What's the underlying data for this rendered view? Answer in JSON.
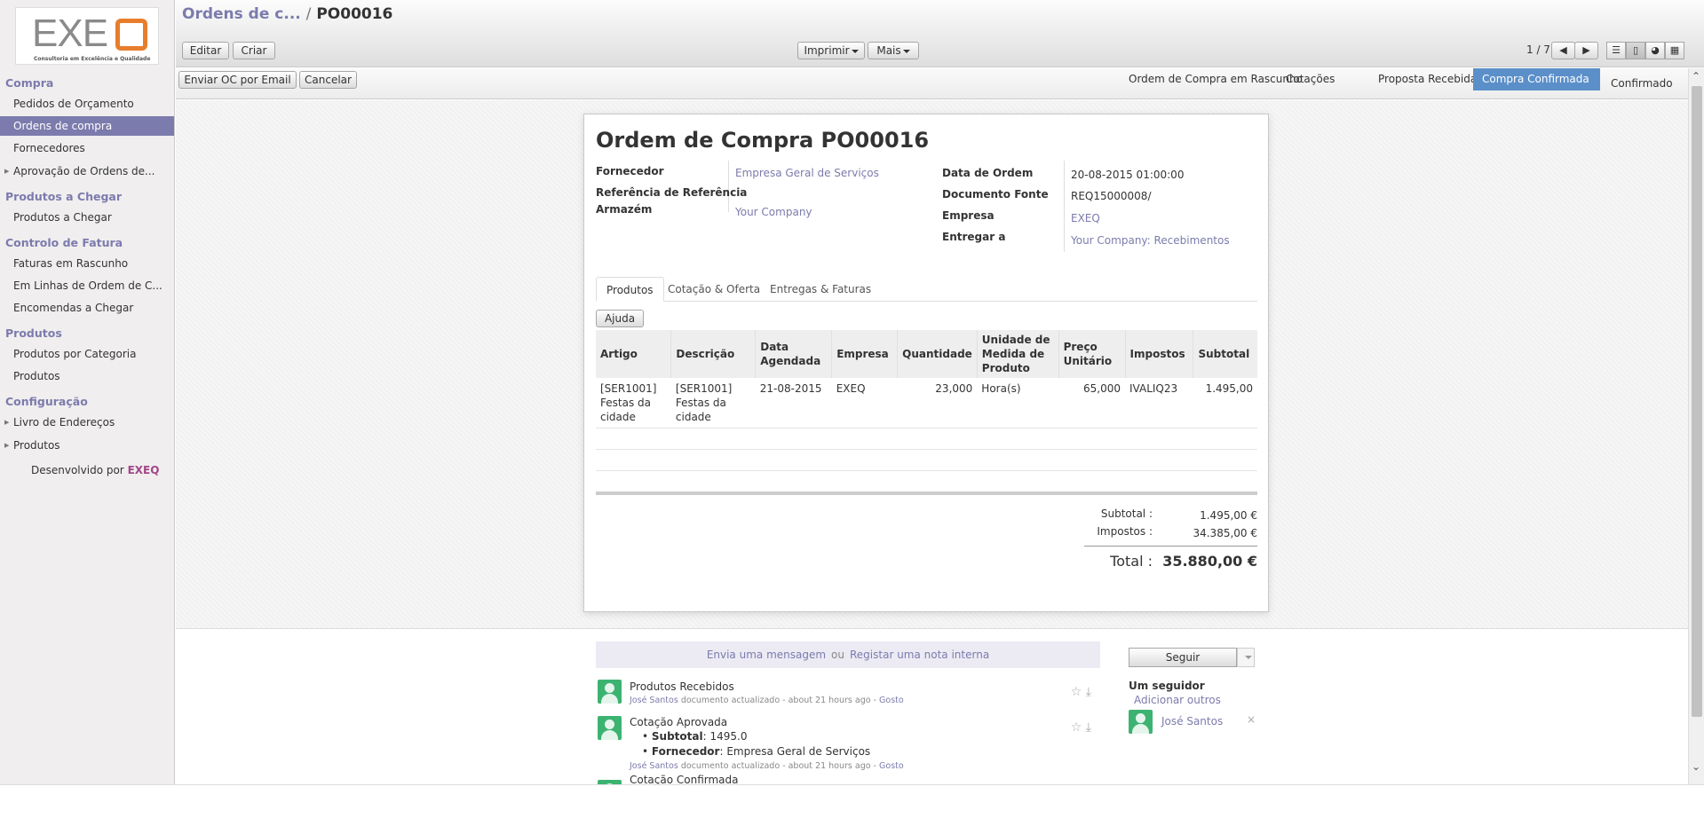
{
  "logo": {
    "text": "EXE",
    "sub": "Consultoria em Excelência e Qualidade"
  },
  "sidebar": {
    "sections": [
      {
        "label": "Compra"
      },
      {
        "label": "Produtos a Chegar"
      },
      {
        "label": "Controlo de Fatura"
      },
      {
        "label": "Produtos"
      },
      {
        "label": "Configuração"
      }
    ],
    "items": [
      {
        "label": "Pedidos de Orçamento"
      },
      {
        "label": "Ordens de compra"
      },
      {
        "label": "Fornecedores"
      },
      {
        "label": "Aprovação de Ordens de..."
      },
      {
        "label": "Produtos a Chegar"
      },
      {
        "label": "Faturas em Rascunho"
      },
      {
        "label": "Em Linhas de Ordem de C..."
      },
      {
        "label": "Encomendas a Chegar"
      },
      {
        "label": "Produtos por Categoria"
      },
      {
        "label": "Produtos"
      },
      {
        "label": "Livro de Endereços"
      },
      {
        "label": "Produtos"
      }
    ],
    "dev_prefix": "Desenvolvido por",
    "dev_brand": "EXEQ"
  },
  "header": {
    "breadcrumb_parent": "Ordens de c...",
    "breadcrumb_sep": "/",
    "breadcrumb_current": "PO00016",
    "edit_label": "Editar",
    "create_label": "Criar",
    "print_label": "Imprimir",
    "more_label": "Mais",
    "pager": "1 / 7"
  },
  "actions": {
    "send_email_label": "Enviar OC por Email",
    "cancel_label": "Cancelar",
    "stages": [
      {
        "label": "Ordem de Compra em Rascunho"
      },
      {
        "label": "Cotações"
      },
      {
        "label": "Proposta Recebida"
      },
      {
        "label": "Compra Confirmada"
      },
      {
        "label": "Confirmado"
      }
    ]
  },
  "form": {
    "title": "Ordem de Compra PO00016",
    "fornecedor_label": "Fornecedor",
    "fornecedor_value": "Empresa Geral de Serviços",
    "ref_label": "Referência de Referência",
    "armazem_label": "Armazém",
    "armazem_value": "Your Company",
    "data_label": "Data de Ordem",
    "data_value": "20-08-2015 01:00:00",
    "fonte_label": "Documento Fonte",
    "fonte_value": "REQ15000008/",
    "empresa_label": "Empresa",
    "empresa_value": "EXEQ",
    "entregar_label": "Entregar a",
    "entregar_value": "Your Company: Recebimentos"
  },
  "tabs": [
    {
      "label": "Produtos"
    },
    {
      "label": "Cotação & Oferta"
    },
    {
      "label": "Entregas & Faturas"
    }
  ],
  "help_label": "Ajuda",
  "grid": {
    "headers": [
      "Artigo",
      "Descrição",
      "Data Agendada",
      "Empresa",
      "Quantidade",
      "Unidade de Medida de Produto",
      "Preço Unitário",
      "Impostos",
      "Subtotal"
    ],
    "rows": [
      [
        "[SER1001] Festas da cidade",
        "[SER1001] Festas da cidade",
        "21-08-2015",
        "EXEQ",
        "23,000",
        "Hora(s)",
        "65,000",
        "IVALIQ23",
        "1.495,00"
      ]
    ]
  },
  "totals": {
    "subtotal_label": "Subtotal :",
    "subtotal_value": "1.495,00 €",
    "taxes_label": "Impostos :",
    "taxes_value": "34.385,00 €",
    "total_label": "Total :",
    "total_value": "35.880,00 €"
  },
  "chatter": {
    "send_message": "Envia uma mensagem",
    "or": "ou",
    "log_note": "Registar uma nota interna",
    "messages": [
      {
        "title": "Produtos Recebidos",
        "author": "José Santos",
        "meta": "documento actualizado - about 21 hours ago -",
        "like": "Gosto"
      },
      {
        "title": "Cotação Aprovada",
        "bullets": [
          {
            "key": "Subtotal",
            "value": ": 1495.0"
          },
          {
            "key": "Fornecedor",
            "value": ": Empresa Geral de Serviços"
          }
        ],
        "author": "José Santos",
        "meta": "documento actualizado - about 21 hours ago -",
        "like": "Gosto"
      },
      {
        "title": "Cotação Confirmada"
      }
    ],
    "follow_label": "Seguir",
    "followers_label": "Um seguidor",
    "add_others_label": "Adicionar outros",
    "follower_name": "José Santos"
  }
}
